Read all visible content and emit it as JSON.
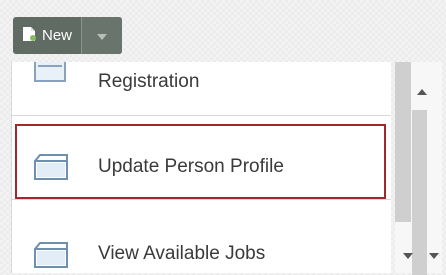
{
  "toolbar": {
    "new_label": "New",
    "new_icon": "new-document-icon",
    "dropdown_icon": "chevron-down-icon"
  },
  "list": {
    "items": [
      {
        "label": "Registration",
        "icon": "form-icon"
      },
      {
        "label": "Update Person Profile",
        "icon": "form-icon",
        "selected": true
      },
      {
        "label": "View Available Jobs",
        "icon": "form-icon"
      }
    ]
  },
  "colors": {
    "button_bg": "#5f6b63",
    "selection_border": "#a3262a",
    "text": "#3a3a3a"
  }
}
